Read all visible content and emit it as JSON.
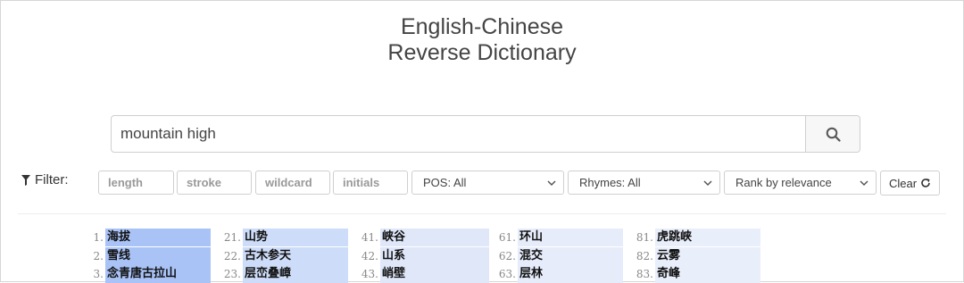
{
  "header": {
    "title_line1": "English-Chinese",
    "title_line2": "Reverse Dictionary"
  },
  "search": {
    "query": "mountain high"
  },
  "icons": {
    "search": "search-icon",
    "filter": "filter-icon",
    "clear": "refresh-icon",
    "dropdown": "chevron-down-icon"
  },
  "filter": {
    "label": "Filter:",
    "length_placeholder": "length",
    "stroke_placeholder": "stroke",
    "wildcard_placeholder": "wildcard",
    "initials_placeholder": "initials",
    "pos": "POS: All",
    "rhymes": "Rhymes: All",
    "rank": "Rank by relevance",
    "clear_label": "Clear"
  },
  "results": {
    "columns": [
      {
        "items": [
          {
            "rank": "1.",
            "word": "海拔"
          },
          {
            "rank": "2.",
            "word": "雪线"
          },
          {
            "rank": "3.",
            "word": "念青唐古拉山"
          }
        ]
      },
      {
        "items": [
          {
            "rank": "21.",
            "word": "山势"
          },
          {
            "rank": "22.",
            "word": "古木参天"
          },
          {
            "rank": "23.",
            "word": "层峦叠嶂"
          }
        ]
      },
      {
        "items": [
          {
            "rank": "41.",
            "word": "峡谷"
          },
          {
            "rank": "42.",
            "word": "山系"
          },
          {
            "rank": "43.",
            "word": "峭壁"
          }
        ]
      },
      {
        "items": [
          {
            "rank": "61.",
            "word": "环山"
          },
          {
            "rank": "62.",
            "word": "混交"
          },
          {
            "rank": "63.",
            "word": "层林"
          }
        ]
      },
      {
        "items": [
          {
            "rank": "81.",
            "word": "虎跳峡"
          },
          {
            "rank": "82.",
            "word": "云雾"
          },
          {
            "rank": "83.",
            "word": "奇峰"
          }
        ]
      }
    ],
    "relevance_colors": [
      "#a9c3f7",
      "#cddcf8",
      "#dfe7f9",
      "#e6ecfa",
      "#e9eefb"
    ]
  }
}
